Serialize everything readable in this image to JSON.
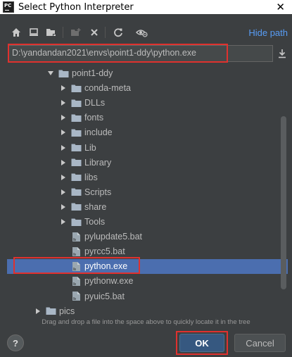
{
  "window": {
    "title": "Select Python Interpreter",
    "app_icon_text": "PC",
    "close_glyph": "✕"
  },
  "toolbar": {
    "icons": [
      "home-icon",
      "desktop-icon",
      "project-folder-icon",
      "new-folder-icon",
      "delete-icon",
      "refresh-icon",
      "show-hidden-icon"
    ],
    "hide_path_label": "Hide path"
  },
  "path": {
    "value": "D:\\yandandan2021\\envs\\point1-ddy\\python.exe"
  },
  "tree": {
    "items": [
      {
        "label": "point1-ddy",
        "type": "folder",
        "expanded": true
      },
      {
        "label": "conda-meta",
        "type": "folder",
        "expanded": false
      },
      {
        "label": "DLLs",
        "type": "folder",
        "expanded": false
      },
      {
        "label": "fonts",
        "type": "folder",
        "expanded": false
      },
      {
        "label": "include",
        "type": "folder",
        "expanded": false
      },
      {
        "label": "Lib",
        "type": "folder",
        "expanded": false
      },
      {
        "label": "Library",
        "type": "folder",
        "expanded": false
      },
      {
        "label": "libs",
        "type": "folder",
        "expanded": false
      },
      {
        "label": "Scripts",
        "type": "folder",
        "expanded": false
      },
      {
        "label": "share",
        "type": "folder",
        "expanded": false
      },
      {
        "label": "Tools",
        "type": "folder",
        "expanded": false
      },
      {
        "label": "pylupdate5.bat",
        "type": "file"
      },
      {
        "label": "pyrcc5.bat",
        "type": "file"
      },
      {
        "label": "python.exe",
        "type": "file",
        "selected": true
      },
      {
        "label": "pythonw.exe",
        "type": "file"
      },
      {
        "label": "pyuic5.bat",
        "type": "file"
      },
      {
        "label": "pics",
        "type": "folder",
        "expanded": false
      }
    ]
  },
  "hint": "Drag and drop a file into the space above to quickly locate it in the tree",
  "buttons": {
    "help": "?",
    "ok": "OK",
    "cancel": "Cancel"
  },
  "colors": {
    "background": "#3c3f41",
    "selection": "#4b6eaf",
    "link": "#589df6",
    "highlight_annotation": "#e0312e",
    "ok_button": "#365880"
  }
}
